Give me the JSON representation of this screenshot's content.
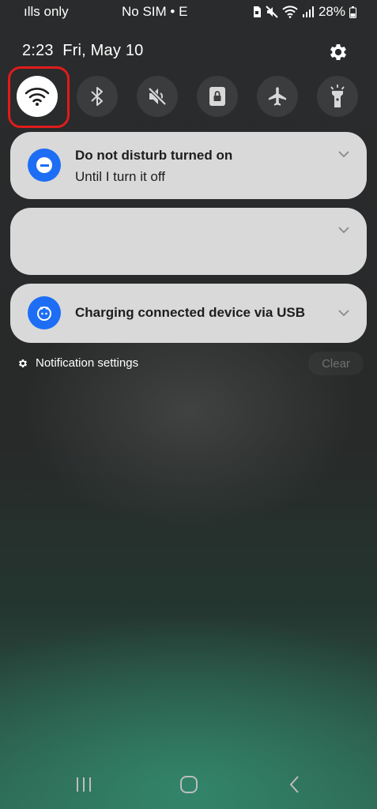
{
  "status_bar": {
    "carrier_left": "ılls only",
    "carrier_center": "No SIM • E",
    "battery": "28%",
    "icons": [
      "sim-lock-icon",
      "mute-icon",
      "wifi-icon",
      "signal-icon",
      "battery-icon"
    ]
  },
  "header": {
    "time": "2:23",
    "date": "Fri, May 10",
    "settings_icon": "gear-icon"
  },
  "quick_toggles": [
    {
      "name": "wifi",
      "icon": "wifi-icon",
      "active": true
    },
    {
      "name": "bluetooth",
      "icon": "bluetooth-icon",
      "active": false
    },
    {
      "name": "sound",
      "icon": "mute-icon",
      "active": false
    },
    {
      "name": "rotation-lock",
      "icon": "rotation-lock-icon",
      "active": false
    },
    {
      "name": "airplane-mode",
      "icon": "airplane-icon",
      "active": false
    },
    {
      "name": "flashlight",
      "icon": "flashlight-icon",
      "active": false
    }
  ],
  "notifications": [
    {
      "title": "Do not disturb turned on",
      "text": "Until I turn it off",
      "icon": "do-not-disturb-icon"
    },
    {
      "title": "",
      "text": "",
      "icon": ""
    },
    {
      "title": "Charging connected device via USB",
      "text": "",
      "icon": "usb-charging-icon"
    }
  ],
  "footer": {
    "notification_settings": "Notification settings",
    "clear": "Clear"
  },
  "nav": [
    "recents-icon",
    "home-icon",
    "back-icon"
  ],
  "colors": {
    "accent_blue": "#1d6ef5",
    "highlight_red": "#e01b1b",
    "card_bg": "#d9d9d9",
    "toggle_bg": "#3b3c3d"
  }
}
